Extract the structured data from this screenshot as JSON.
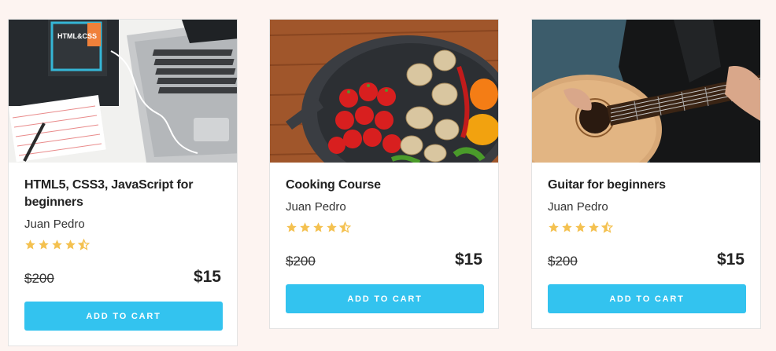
{
  "courses": [
    {
      "title": "HTML5, CSS3, JavaScript for beginners",
      "author": "Juan Pedro",
      "rating": 4.5,
      "old_price": "$200",
      "price": "$15",
      "button": "ADD TO CART",
      "book_text": "HTML&CSS"
    },
    {
      "title": "Cooking Course",
      "author": "Juan Pedro",
      "rating": 4.5,
      "old_price": "$200",
      "price": "$15",
      "button": "ADD TO CART"
    },
    {
      "title": "Guitar for beginners",
      "author": "Juan Pedro",
      "rating": 4.5,
      "old_price": "$200",
      "price": "$15",
      "button": "ADD TO CART"
    }
  ],
  "colors": {
    "background": "#fdf4f1",
    "accent": "#33c3ef",
    "star": "#f4c150"
  }
}
